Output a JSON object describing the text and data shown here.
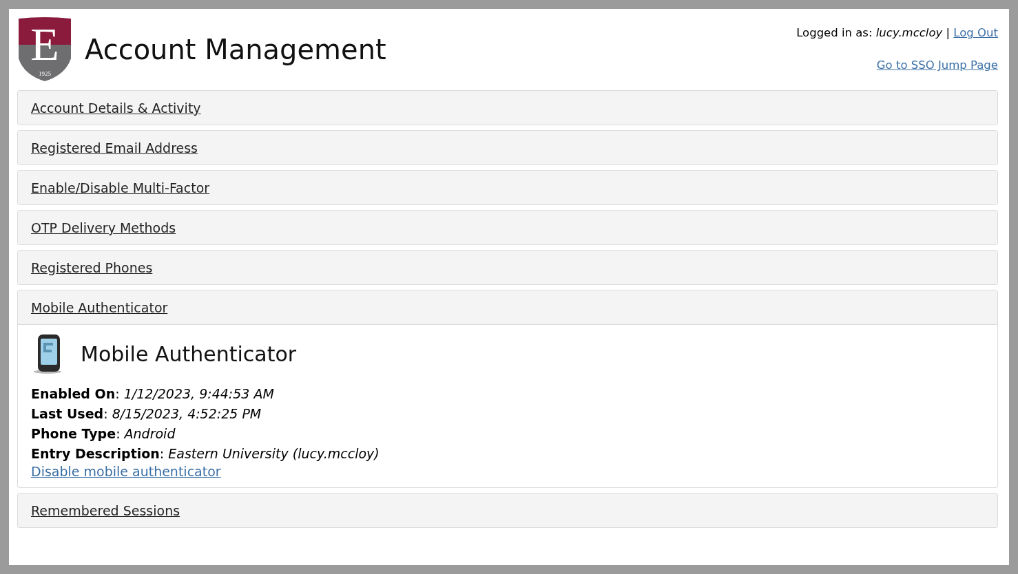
{
  "logo": {
    "letter": "E",
    "year": "1925"
  },
  "title": "Account Management",
  "user_bar": {
    "label": "Logged in as:",
    "username": "lucy.mccloy",
    "separator": "|",
    "logout": "Log Out",
    "jump_link": "Go to SSO Jump Page"
  },
  "sections": [
    {
      "title": "Account Details & Activity",
      "expanded": false
    },
    {
      "title": "Registered Email Address",
      "expanded": false
    },
    {
      "title": "Enable/Disable Multi-Factor",
      "expanded": false
    },
    {
      "title": "OTP Delivery Methods",
      "expanded": false
    },
    {
      "title": "Registered Phones",
      "expanded": false
    },
    {
      "title": "Mobile Authenticator",
      "expanded": true,
      "panel": {
        "heading": "Mobile Authenticator",
        "fields": [
          {
            "label": "Enabled On",
            "separator": ":",
            "value": "1/12/2023, 9:44:53 AM"
          },
          {
            "label": "Last Used",
            "separator": ":",
            "value": "8/15/2023, 4:52:25 PM"
          },
          {
            "label": "Phone Type",
            "separator": ":",
            "value": "Android"
          },
          {
            "label": "Entry Description",
            "separator": ":",
            "value": "Eastern University (lucy.mccloy)"
          }
        ],
        "action": "Disable mobile authenticator"
      }
    },
    {
      "title": "Remembered Sessions",
      "expanded": false
    }
  ]
}
